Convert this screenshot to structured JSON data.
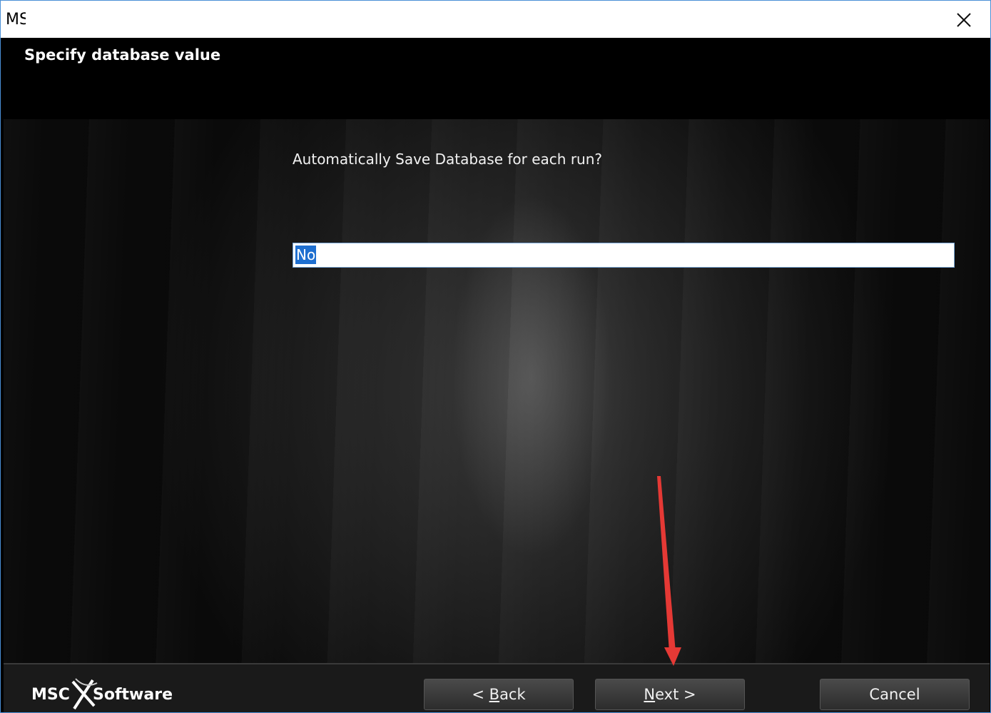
{
  "window": {
    "title": "MS"
  },
  "header": {
    "heading": "Specify database value"
  },
  "content": {
    "question": "Automatically Save Database for each run?",
    "field_value": "No"
  },
  "footer": {
    "logo_text_left": "MSC",
    "logo_text_right": "Software",
    "back_label_prefix": "< ",
    "back_label_mnemonic": "B",
    "back_label_rest": "ack",
    "next_label_mnemonic": "N",
    "next_label_rest": "ext >",
    "cancel_label": "Cancel"
  },
  "colors": {
    "selection": "#1e6fd0",
    "annotation_arrow": "#e53935",
    "window_border": "#4a8fd6"
  },
  "icons": {
    "close": "close-icon",
    "annotation": "red-arrow-annotation"
  }
}
